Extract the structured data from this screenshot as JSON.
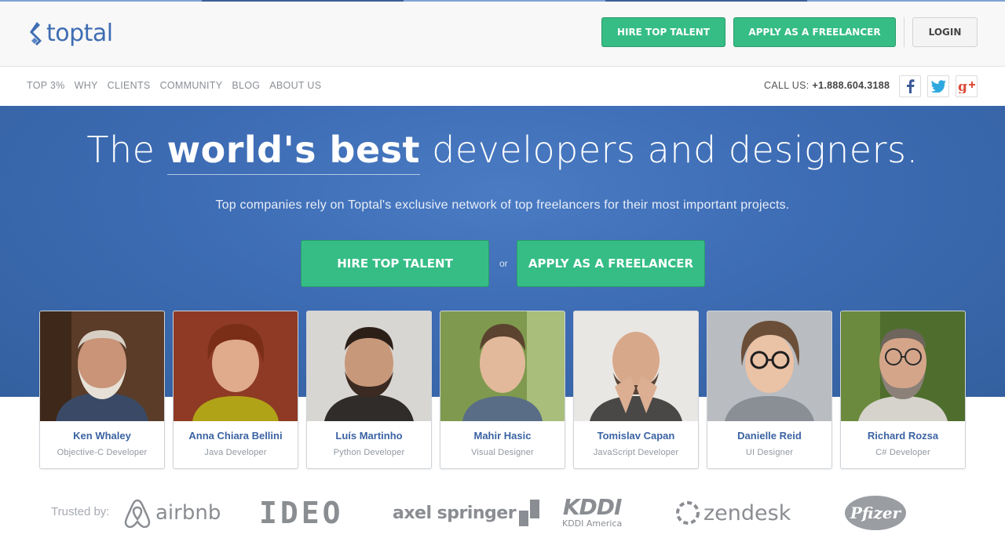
{
  "header": {
    "logo_text": "toptal",
    "hire_label": "HIRE TOP TALENT",
    "apply_label": "APPLY AS A FREELANCER",
    "login_label": "LOGIN"
  },
  "nav": {
    "links": [
      "TOP 3%",
      "WHY",
      "CLIENTS",
      "COMMUNITY",
      "BLOG",
      "ABOUT US"
    ],
    "call_label": "CALL US:",
    "phone": "+1.888.604.3188",
    "social_icons": [
      "facebook-icon",
      "twitter-icon",
      "google-plus-icon"
    ]
  },
  "hero": {
    "headline_pre": "The",
    "headline_strong": "world's best",
    "headline_post": "developers and designers.",
    "subheadline": "Top companies rely on Toptal's exclusive network of top freelancers for their most important projects.",
    "hire_label": "HIRE TOP TALENT",
    "or_label": "or",
    "apply_label": "APPLY AS A FREELANCER"
  },
  "talent": [
    {
      "name": "Ken Whaley",
      "role": "Objective-C Developer"
    },
    {
      "name": "Anna Chiara Bellini",
      "role": "Java Developer"
    },
    {
      "name": "Luís Martinho",
      "role": "Python Developer"
    },
    {
      "name": "Mahir Hasic",
      "role": "Visual Designer"
    },
    {
      "name": "Tomislav Capan",
      "role": "JavaScript Developer"
    },
    {
      "name": "Danielle Reid",
      "role": "UI Designer"
    },
    {
      "name": "Richard Rozsa",
      "role": "C# Developer"
    }
  ],
  "trusted": {
    "label": "Trusted by:",
    "logos": [
      "airbnb",
      "IDEO",
      "axel springer",
      "KDDI",
      "KDDI America",
      "zendesk",
      "Pfizer"
    ]
  },
  "colors": {
    "brand_blue": "#3f6db3",
    "hero_blue": "#3d6cb4",
    "accent_green": "#35bd85",
    "name_blue": "#3b63a3"
  }
}
